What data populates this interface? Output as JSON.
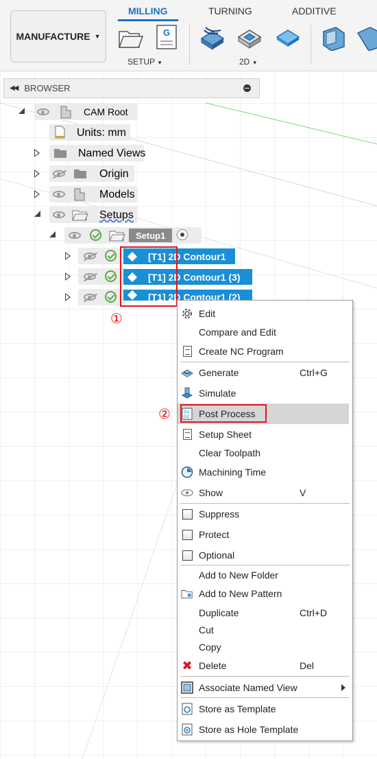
{
  "toolbar": {
    "workspace": "MANUFACTURE",
    "tabs": [
      "MILLING",
      "TURNING",
      "ADDITIVE"
    ],
    "active_tab": "MILLING",
    "groups": [
      "SETUP",
      "2D"
    ],
    "accent": "#1a72c7"
  },
  "browser": {
    "title": "BROWSER",
    "root": "CAM Root",
    "units": "Units: mm",
    "named_views": "Named Views",
    "origin": "Origin",
    "models": "Models",
    "setups": "Setups",
    "setup1": "Setup1",
    "operations": [
      "[T1] 2D Contour1",
      "[T1] 2D Contour1 (3)",
      "[T1] 2D Contour1 (2)"
    ]
  },
  "annotations": {
    "step1": "①",
    "step2": "②",
    "color": "#e0141c"
  },
  "menu": {
    "items": [
      {
        "label": "Edit",
        "shortcut": "",
        "icon": "gear-icon"
      },
      {
        "label": "Compare and Edit",
        "shortcut": "",
        "icon": ""
      },
      {
        "label": "Create NC Program",
        "shortcut": "",
        "icon": "nc-program-icon"
      },
      {
        "label": "Generate",
        "shortcut": "Ctrl+G",
        "icon": "generate-icon"
      },
      {
        "label": "Simulate",
        "shortcut": "",
        "icon": "simulate-icon"
      },
      {
        "label": "Post Process",
        "shortcut": "",
        "icon": "post-process-icon"
      },
      {
        "label": "Setup Sheet",
        "shortcut": "",
        "icon": "setup-sheet-icon"
      },
      {
        "label": "Clear Toolpath",
        "shortcut": "",
        "icon": ""
      },
      {
        "label": "Machining Time",
        "shortcut": "",
        "icon": "clock-icon"
      },
      {
        "label": "Show",
        "shortcut": "V",
        "icon": "eye-icon"
      },
      {
        "label": "Suppress",
        "shortcut": "",
        "icon": "checkbox-icon"
      },
      {
        "label": "Protect",
        "shortcut": "",
        "icon": "checkbox-icon"
      },
      {
        "label": "Optional",
        "shortcut": "",
        "icon": "checkbox-icon"
      },
      {
        "label": "Add to New Folder",
        "shortcut": "",
        "icon": ""
      },
      {
        "label": "Add to New Pattern",
        "shortcut": "",
        "icon": "pattern-icon"
      },
      {
        "label": "Duplicate",
        "shortcut": "Ctrl+D",
        "icon": ""
      },
      {
        "label": "Cut",
        "shortcut": "",
        "icon": ""
      },
      {
        "label": "Copy",
        "shortcut": "",
        "icon": ""
      },
      {
        "label": "Delete",
        "shortcut": "Del",
        "icon": "delete-icon"
      },
      {
        "label": "Associate Named View",
        "shortcut": "",
        "icon": "named-view-icon"
      },
      {
        "label": "Store as Template",
        "shortcut": "",
        "icon": "template-icon"
      },
      {
        "label": "Store as Hole Template",
        "shortcut": "",
        "icon": "hole-template-icon"
      }
    ]
  }
}
